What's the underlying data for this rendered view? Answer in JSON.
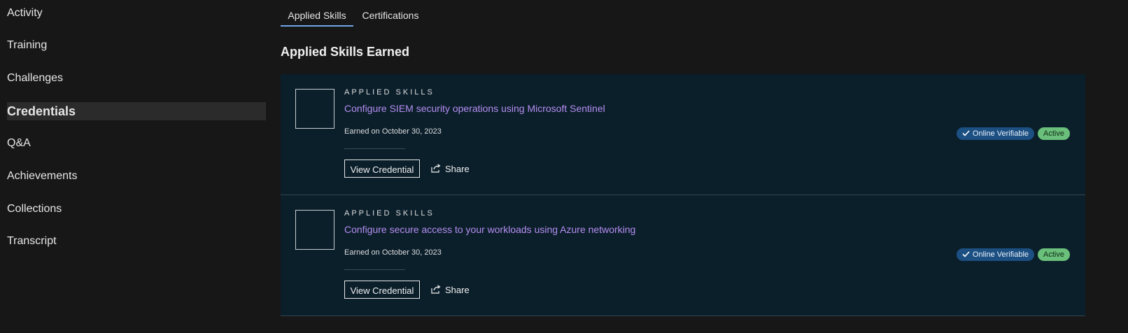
{
  "sidebar": {
    "items": [
      {
        "label": "Activity"
      },
      {
        "label": "Training"
      },
      {
        "label": "Challenges"
      },
      {
        "label": "Credentials"
      },
      {
        "label": "Q&A"
      },
      {
        "label": "Achievements"
      },
      {
        "label": "Collections"
      },
      {
        "label": "Transcript"
      }
    ],
    "active": "Credentials"
  },
  "tabs": [
    {
      "label": "Applied Skills"
    },
    {
      "label": "Certifications"
    }
  ],
  "active_tab": "Applied Skills",
  "section_title": "Applied Skills Earned",
  "credentials": [
    {
      "kicker": "APPLIED SKILLS",
      "title": "Configure SIEM security operations using Microsoft Sentinel",
      "earned": "Earned on October 30, 2023",
      "view_label": "View Credential",
      "share_label": "Share",
      "verify_badge": "Online Verifiable",
      "status_badge": "Active"
    },
    {
      "kicker": "APPLIED SKILLS",
      "title": "Configure secure access to your workloads using Azure networking",
      "earned": "Earned on October 30, 2023",
      "view_label": "View Credential",
      "share_label": "Share",
      "verify_badge": "Online Verifiable",
      "status_badge": "Active"
    }
  ],
  "colors": {
    "background": "#171717",
    "card_background": "#0b1f2b",
    "link": "#b58ef0",
    "tab_underline": "#6ea5e6",
    "verify_badge": "#1c4f82",
    "active_badge": "#6abf7a"
  },
  "icons": {
    "share": "share-icon",
    "verified": "checkmark-icon"
  }
}
